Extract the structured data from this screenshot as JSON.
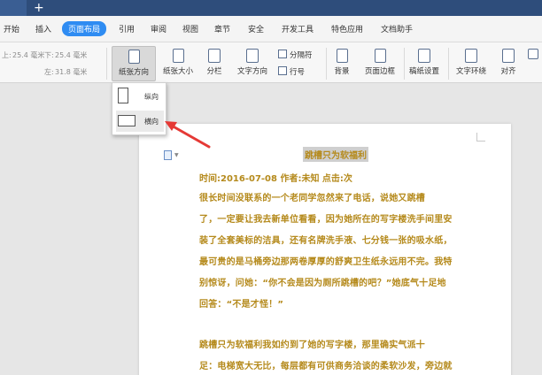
{
  "tabs": {
    "new_tab": "+"
  },
  "menu": {
    "items": [
      "开始",
      "插入",
      "页面布局",
      "引用",
      "审阅",
      "视图",
      "章节",
      "安全",
      "开发工具",
      "特色应用",
      "文档助手"
    ],
    "active": "页面布局"
  },
  "toolbar": {
    "margin_top_label": "上:",
    "margin_top_value": "25.4 毫米",
    "margin_bottom_label": "下:",
    "margin_bottom_value": "25.4 毫米",
    "margin_left_label": "左:",
    "margin_left_value": "31.8 毫米",
    "orientation": "纸张方向",
    "size": "纸张大小",
    "columns": "分栏",
    "text_direction": "文字方向",
    "separator": "分隔符",
    "line_number": "行号",
    "background": "背景",
    "page_border": "页面边框",
    "manuscript": "稿纸设置",
    "text_wrap": "文字环绕",
    "align": "对齐"
  },
  "dropdown": {
    "portrait": "纵向",
    "landscape": "横向"
  },
  "document": {
    "title": "跳槽只为软福利",
    "meta": "时间:2016-07-08  作者:未知  点击:次",
    "lines": [
      "    很长时间没联系的一个老同学忽然来了电话，说她又跳槽",
      "了，一定要让我去新单位看看，因为她所在的写字楼洗手间里安",
      "装了全套美标的洁具，还有名牌洗手液、七分钱一张的吸水纸，",
      "最可贵的是马桶旁边那两卷厚厚的舒爽卫生纸永远用不完。我特",
      "别惊讶，问她：“你不会是因为厕所跳槽的吧？”她底气十足地",
      "回答：“不是才怪！”",
      "",
      "    跳槽只为软福利我如约到了她的写字楼，那里确实气派十",
      "足：电梯宽大无比，每层都有可供商务洽谈的柔软沙发，旁边就"
    ]
  }
}
